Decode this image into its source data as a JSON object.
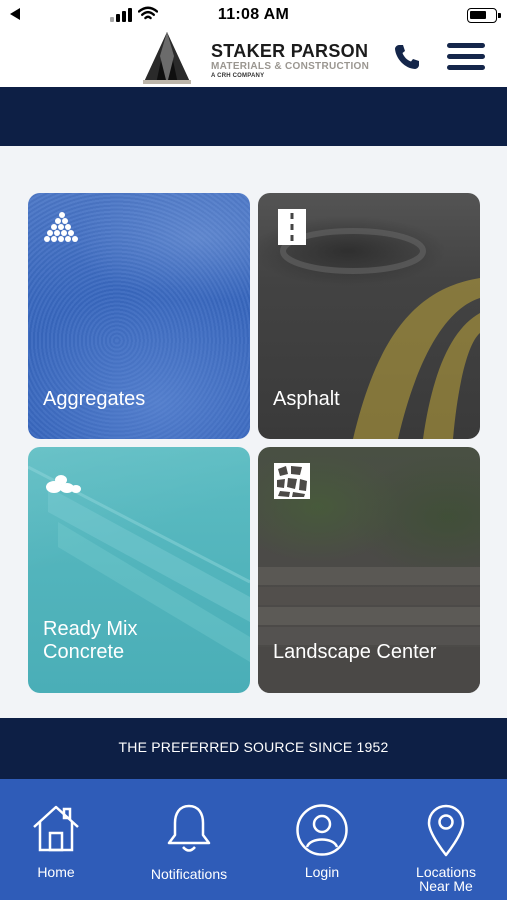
{
  "status_bar": {
    "time": "11:08 AM",
    "icons": [
      "back-arrow-icon",
      "cellular-signal-icon",
      "wifi-icon",
      "battery-icon"
    ]
  },
  "header": {
    "brand_name": "STAKER PARSON",
    "brand_subtitle": "MATERIALS & CONSTRUCTION",
    "brand_tagline": "A CRH COMPANY",
    "icons": [
      "phone-icon",
      "hamburger-menu-icon"
    ]
  },
  "tiles": [
    {
      "label": "Aggregates",
      "icon": "aggregates-icon"
    },
    {
      "label": "Asphalt",
      "icon": "road-icon"
    },
    {
      "label": "Ready Mix",
      "label_line2": "Concrete",
      "icon": "stones-icon"
    },
    {
      "label": "Landscape Center",
      "icon": "flagstone-icon"
    }
  ],
  "tagline": "THE PREFERRED SOURCE SINCE 1952",
  "tab_bar": [
    {
      "label": "Home",
      "icon": "home-icon"
    },
    {
      "label": "Notifications",
      "icon": "bell-icon"
    },
    {
      "label": "Login",
      "icon": "user-icon"
    },
    {
      "label": "Locations",
      "label_line2": "Near Me",
      "icon": "location-pin-icon"
    }
  ],
  "colors": {
    "navy": "#0d1f45",
    "tab_bar_blue": "#2f5cb8",
    "aggregates_blue": "#3968bf",
    "concrete_teal": "#52b4bc"
  }
}
